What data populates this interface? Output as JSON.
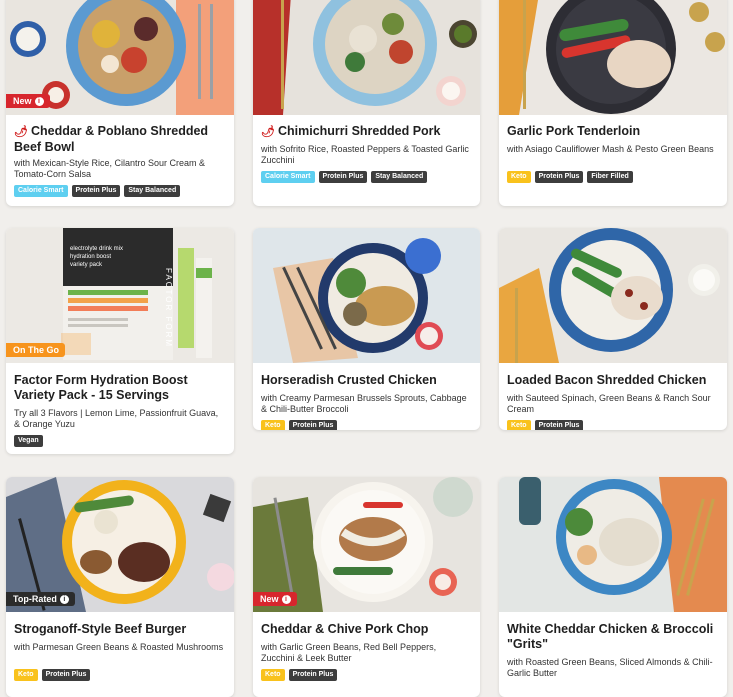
{
  "colors": {
    "page_bg": "#f1efec",
    "new_tag": "#d7262d",
    "on_the_go_tag": "#f7941d",
    "top_rated_tag": "#2b2b2b",
    "calorie_smart": "#5ecff0",
    "keto": "#f9c21c",
    "dark_badge": "#3d3d3d",
    "spicy": "#d01c1c"
  },
  "cards": [
    {
      "tag": "New",
      "spicy": true,
      "title": "Cheddar & Poblano Shredded Beef Bowl",
      "desc": "with Mexican-Style Rice, Cilantro Sour Cream & Tomato-Corn Salsa",
      "badges": [
        "Calorie Smart",
        "Protein Plus",
        "Stay Balanced"
      ]
    },
    {
      "tag": "",
      "spicy": true,
      "title": "Chimichurri Shredded Pork",
      "desc": "with Sofrito Rice, Roasted Peppers & Toasted Garlic Zucchini",
      "badges": [
        "Calorie Smart",
        "Protein Plus",
        "Stay Balanced"
      ]
    },
    {
      "tag": "",
      "spicy": false,
      "title": "Garlic Pork Tenderloin",
      "desc": "with Asiago Cauliflower Mash & Pesto Green Beans",
      "badges": [
        "Keto",
        "Protein Plus",
        "Fiber Filled"
      ]
    },
    {
      "tag": "On The Go",
      "spicy": false,
      "title": "Factor Form Hydration Boost Variety Pack - 15 Servings",
      "desc": "Try all 3 Flavors | Lemon Lime, Passionfruit Guava, & Orange Yuzu",
      "badges": [
        "Vegan"
      ],
      "product_text": [
        "electrolyte drink mix",
        "hydration boost",
        "variety pack",
        "FACTOR FORM"
      ]
    },
    {
      "tag": "",
      "spicy": false,
      "title": "Horseradish Crusted Chicken",
      "desc": "with Creamy Parmesan Brussels Sprouts, Cabbage & Chili-Butter Broccoli",
      "badges": [
        "Keto",
        "Protein Plus"
      ]
    },
    {
      "tag": "",
      "spicy": false,
      "title": "Loaded Bacon Shredded Chicken",
      "desc": "with Sauteed Spinach, Green Beans & Ranch Sour Cream",
      "badges": [
        "Keto",
        "Protein Plus"
      ]
    },
    {
      "tag": "Top-Rated",
      "spicy": false,
      "title": "Stroganoff-Style Beef Burger",
      "desc": "with Parmesan Green Beans & Roasted Mushrooms",
      "badges": [
        "Keto",
        "Protein Plus"
      ]
    },
    {
      "tag": "New",
      "spicy": false,
      "title": "Cheddar & Chive Pork Chop",
      "desc": "with Garlic Green Beans, Red Bell Peppers, Zucchini & Leek Butter",
      "badges": [
        "Keto",
        "Protein Plus"
      ]
    },
    {
      "tag": "",
      "spicy": false,
      "title": "White Cheddar Chicken & Broccoli \"Grits\"",
      "desc": "with Roasted Green Beans, Sliced Almonds & Chili-Garlic Butter",
      "badges": []
    }
  ]
}
